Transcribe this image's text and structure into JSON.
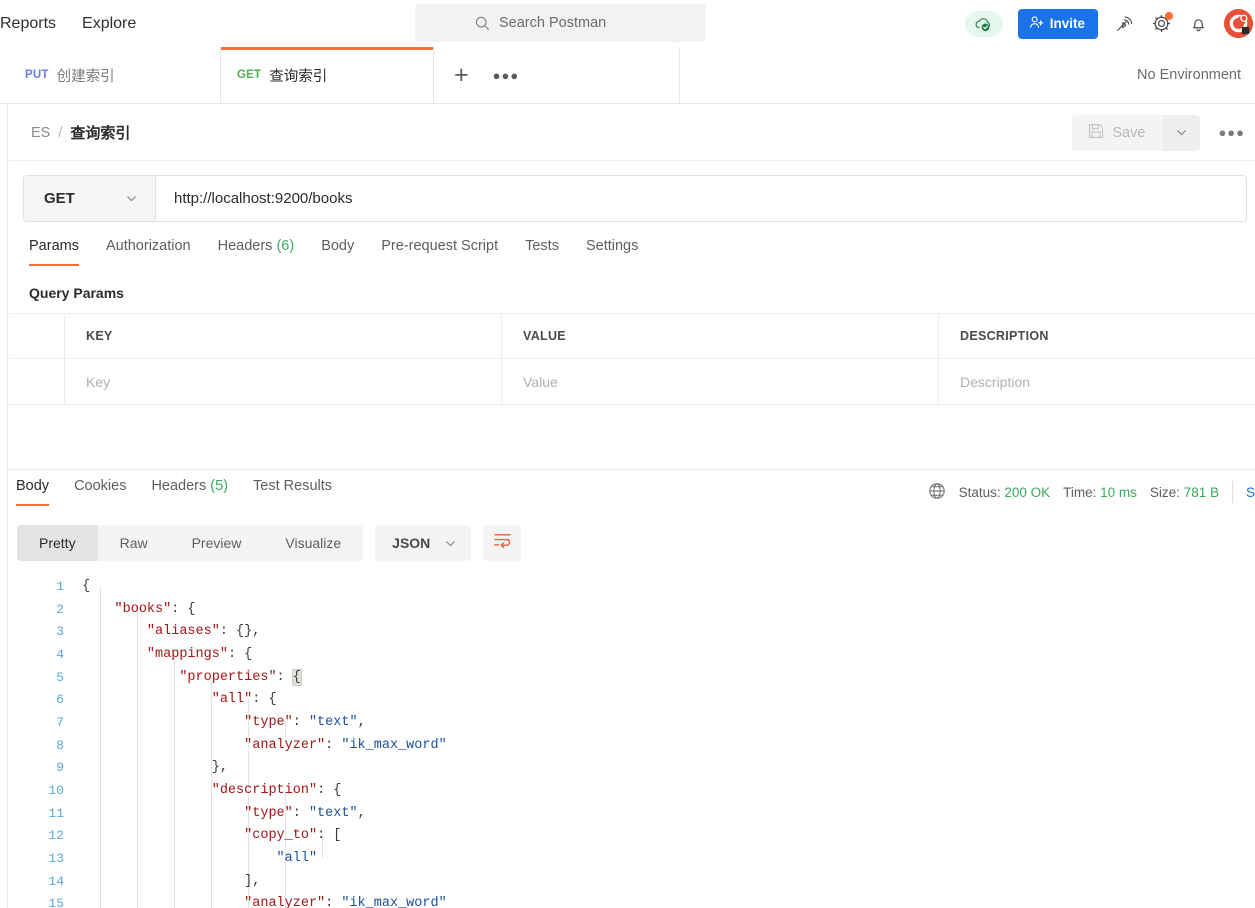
{
  "topbar": {
    "nav": [
      {
        "label": "Reports",
        "name": "topnav-reports"
      },
      {
        "label": "Explore",
        "name": "topnav-explore"
      }
    ],
    "search_placeholder": "Search Postman",
    "invite_label": "Invite",
    "icons": {
      "search": "search-icon",
      "cloud_sync": "cloud-sync-icon",
      "invite_person": "person-add-icon",
      "broadcast": "broadcast-icon",
      "gear": "gear-icon",
      "bell": "bell-icon",
      "avatar": "user-avatar"
    },
    "colors": {
      "invite_bg": "#1a73e8",
      "accent": "#ff6c37",
      "notification_dot": "#ff6c37"
    }
  },
  "tabs": [
    {
      "method": "PUT",
      "title": "创建索引",
      "active": false,
      "method_color": "#6c7ce0"
    },
    {
      "method": "GET",
      "title": "查询索引",
      "active": true,
      "method_color": "#4caf50"
    }
  ],
  "tabbar": {
    "new_tab_icon": "plus-icon",
    "more_icon": "ellipsis-icon",
    "environment": "No Environment"
  },
  "breadcrumb": {
    "root": "ES",
    "separator": "/",
    "current": "查询索引",
    "save_label": "Save",
    "save_icon": "floppy-disk-icon",
    "caret_icon": "chevron-down-icon",
    "more_icon": "ellipsis-icon"
  },
  "request": {
    "method": "GET",
    "url": "http://localhost:9200/books",
    "method_caret_icon": "chevron-down-icon",
    "tabs": [
      {
        "label": "Params",
        "active": true
      },
      {
        "label": "Authorization",
        "active": false
      },
      {
        "label": "Headers",
        "count": "(6)",
        "active": false
      },
      {
        "label": "Body",
        "active": false
      },
      {
        "label": "Pre-request Script",
        "active": false
      },
      {
        "label": "Tests",
        "active": false
      },
      {
        "label": "Settings",
        "active": false
      }
    ],
    "query_params_title": "Query Params",
    "table": {
      "headers": [
        "KEY",
        "VALUE",
        "DESCRIPTION"
      ],
      "rows": [
        {
          "key": "Key",
          "value": "Value",
          "description": "Description",
          "placeholder": true
        }
      ]
    }
  },
  "response": {
    "tabs": [
      {
        "label": "Body",
        "active": true
      },
      {
        "label": "Cookies",
        "active": false
      },
      {
        "label": "Headers",
        "count": "(5)",
        "active": false
      },
      {
        "label": "Test Results",
        "active": false
      }
    ],
    "meta": {
      "globe_icon": "globe-icon",
      "status_label": "Status:",
      "status_value": "200 OK",
      "time_label": "Time:",
      "time_value": "10 ms",
      "size_label": "Size:",
      "size_value": "781 B",
      "save_response": "S",
      "value_color": "#3aaa5e"
    },
    "view_modes": [
      {
        "label": "Pretty",
        "active": true
      },
      {
        "label": "Raw",
        "active": false
      },
      {
        "label": "Preview",
        "active": false
      },
      {
        "label": "Visualize",
        "active": false
      }
    ],
    "format": "JSON",
    "format_caret_icon": "chevron-down-icon",
    "wrap_icon": "wrap-text-icon",
    "body_lines": [
      {
        "n": "1",
        "indent": 0,
        "parts": [
          {
            "t": "p",
            "v": "{"
          }
        ]
      },
      {
        "n": "2",
        "indent": 1,
        "parts": [
          {
            "t": "k",
            "v": "\"books\""
          },
          {
            "t": "p",
            "v": ": {"
          }
        ]
      },
      {
        "n": "3",
        "indent": 2,
        "parts": [
          {
            "t": "k",
            "v": "\"aliases\""
          },
          {
            "t": "p",
            "v": ": {},"
          }
        ]
      },
      {
        "n": "4",
        "indent": 2,
        "parts": [
          {
            "t": "k",
            "v": "\"mappings\""
          },
          {
            "t": "p",
            "v": ": {"
          }
        ]
      },
      {
        "n": "5",
        "indent": 3,
        "parts": [
          {
            "t": "k",
            "v": "\"properties\""
          },
          {
            "t": "p",
            "v": ": "
          },
          {
            "t": "hl",
            "v": "{"
          }
        ]
      },
      {
        "n": "6",
        "indent": 4,
        "parts": [
          {
            "t": "k",
            "v": "\"all\""
          },
          {
            "t": "p",
            "v": ": {"
          }
        ]
      },
      {
        "n": "7",
        "indent": 5,
        "parts": [
          {
            "t": "k",
            "v": "\"type\""
          },
          {
            "t": "p",
            "v": ": "
          },
          {
            "t": "s",
            "v": "\"text\""
          },
          {
            "t": "p",
            "v": ","
          }
        ]
      },
      {
        "n": "8",
        "indent": 5,
        "parts": [
          {
            "t": "k",
            "v": "\"analyzer\""
          },
          {
            "t": "p",
            "v": ": "
          },
          {
            "t": "s",
            "v": "\"ik_max_word\""
          }
        ]
      },
      {
        "n": "9",
        "indent": 4,
        "parts": [
          {
            "t": "p",
            "v": "},"
          }
        ]
      },
      {
        "n": "10",
        "indent": 4,
        "parts": [
          {
            "t": "k",
            "v": "\"description\""
          },
          {
            "t": "p",
            "v": ": {"
          }
        ]
      },
      {
        "n": "11",
        "indent": 5,
        "parts": [
          {
            "t": "k",
            "v": "\"type\""
          },
          {
            "t": "p",
            "v": ": "
          },
          {
            "t": "s",
            "v": "\"text\""
          },
          {
            "t": "p",
            "v": ","
          }
        ]
      },
      {
        "n": "12",
        "indent": 5,
        "parts": [
          {
            "t": "k",
            "v": "\"copy_to\""
          },
          {
            "t": "p",
            "v": ": ["
          }
        ]
      },
      {
        "n": "13",
        "indent": 6,
        "parts": [
          {
            "t": "s",
            "v": "\"all\""
          }
        ]
      },
      {
        "n": "14",
        "indent": 5,
        "parts": [
          {
            "t": "p",
            "v": "],"
          }
        ]
      },
      {
        "n": "15",
        "indent": 5,
        "parts": [
          {
            "t": "k",
            "v": "\"analyzer\""
          },
          {
            "t": "p",
            "v": ": "
          },
          {
            "t": "s",
            "v": "\"ik_max_word\""
          }
        ]
      }
    ]
  }
}
